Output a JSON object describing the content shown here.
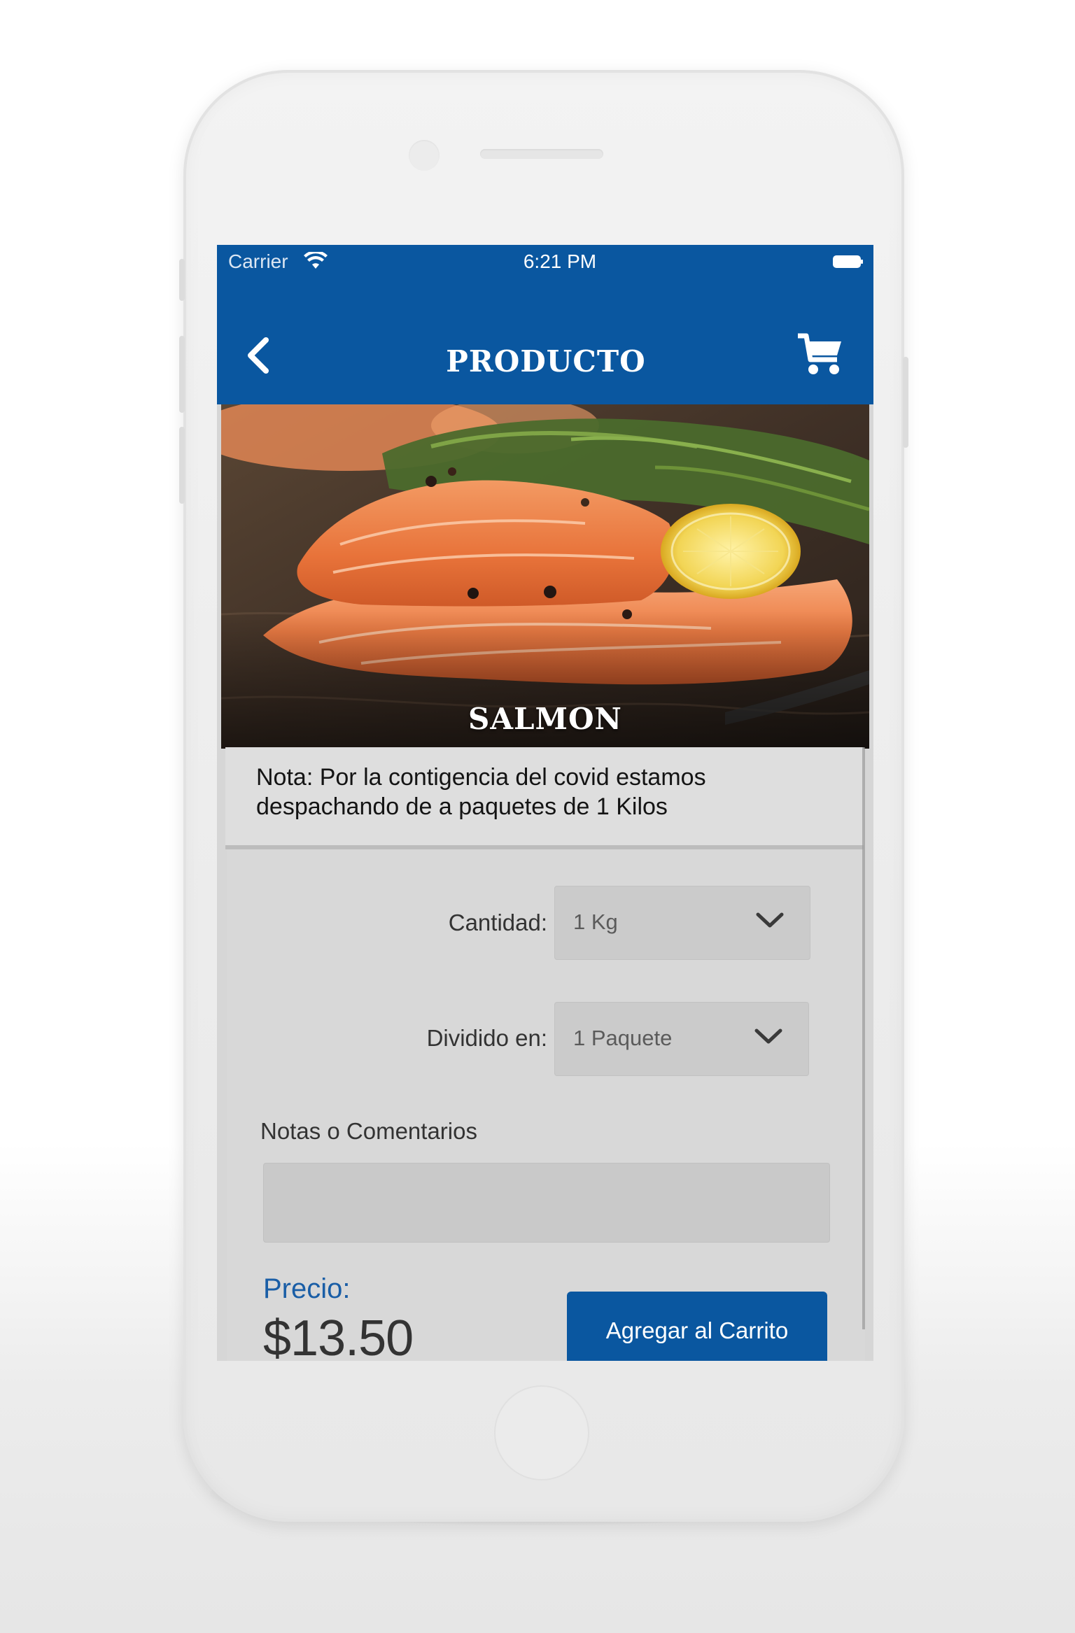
{
  "status_bar": {
    "carrier": "Carrier",
    "time": "6:21 PM"
  },
  "nav": {
    "title": "PRODUCTO",
    "back_icon": "chevron-left-icon",
    "cart_icon": "shopping-cart-icon"
  },
  "product": {
    "name": "SALMON",
    "note": "Nota: Por la contigencia del covid estamos despachando de a paquetes de 1 Kilos"
  },
  "form": {
    "quantity_label": "Cantidad:",
    "quantity_value": "1 Kg",
    "split_label": "Dividido en:",
    "split_value": "1 Paquete",
    "comments_label": "Notas o Comentarios",
    "comments_value": ""
  },
  "price": {
    "label": "Precio:",
    "value": "$13.50"
  },
  "actions": {
    "add_to_cart": "Agregar al Carrito"
  },
  "colors": {
    "brand_blue": "#0a57a0",
    "price_label_blue": "#1a5ea6",
    "screen_background": "#d6d6d6"
  }
}
